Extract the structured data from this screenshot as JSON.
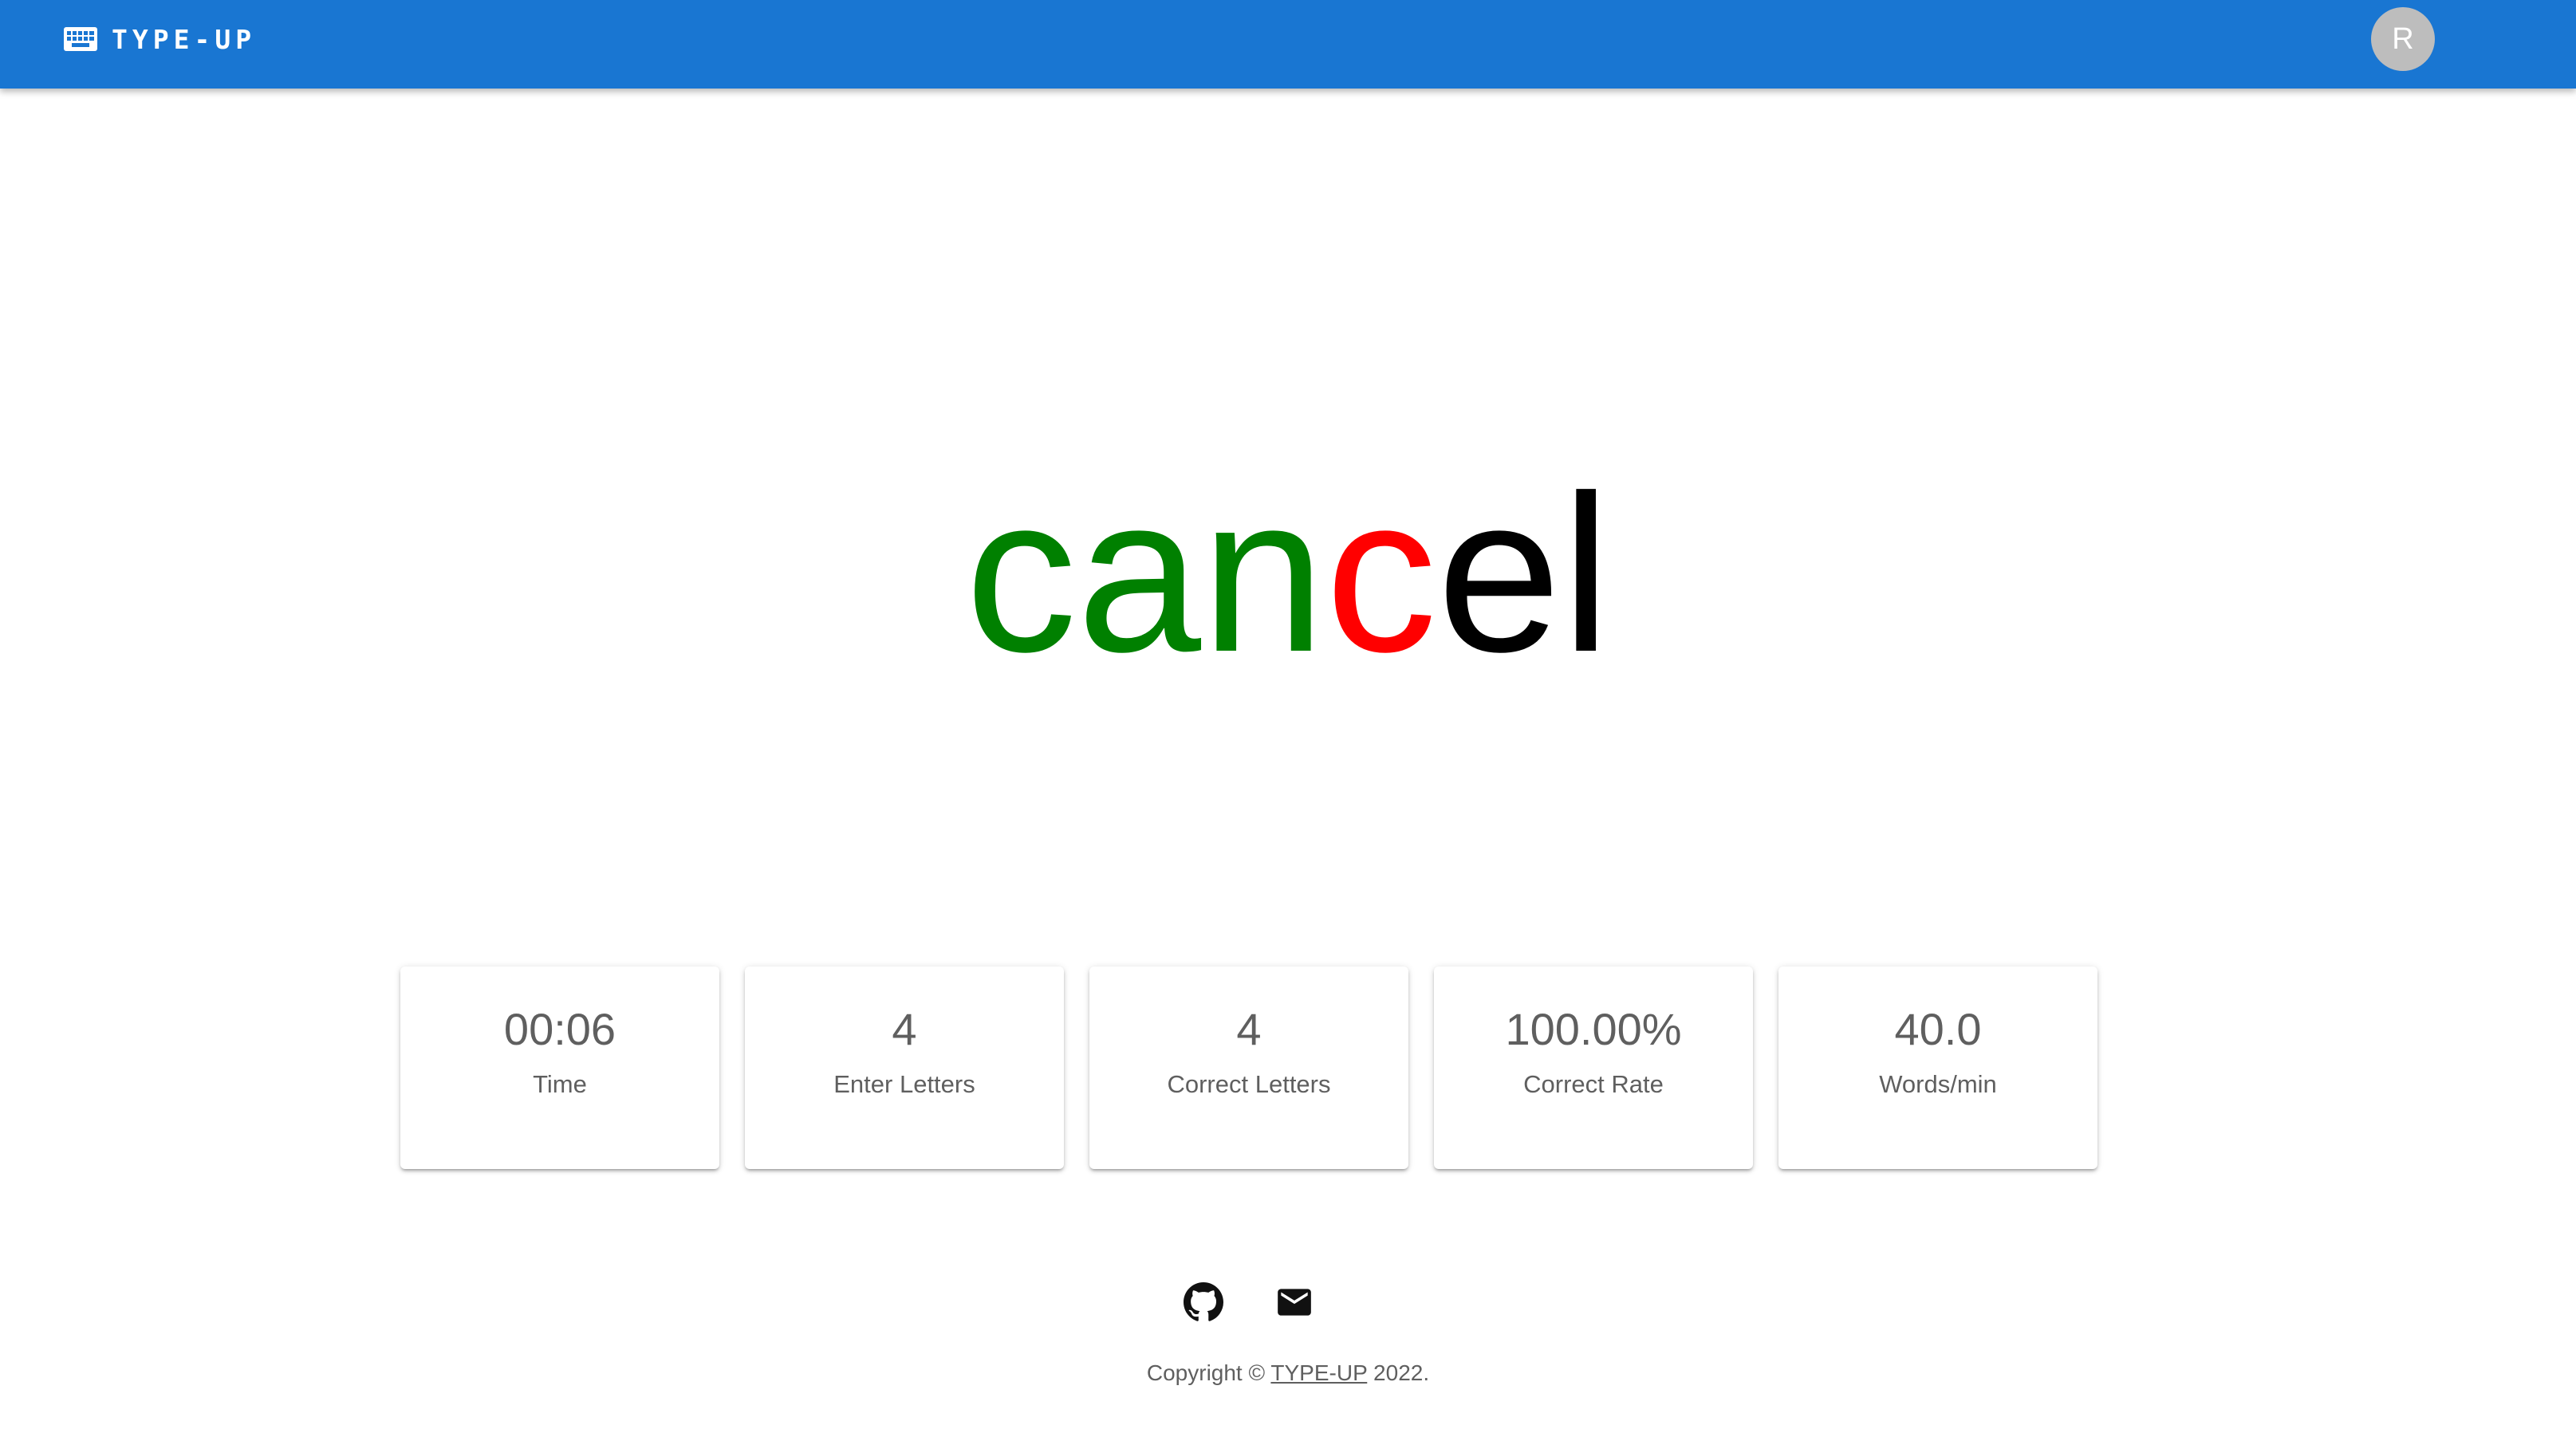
{
  "header": {
    "brand_name": "TYPE-UP",
    "brand_icon": "keyboard-icon",
    "avatar_initial": "R",
    "background_color": "#1976d2"
  },
  "practice": {
    "word": "cancel",
    "letters": [
      {
        "char": "c",
        "state": "correct"
      },
      {
        "char": "a",
        "state": "correct"
      },
      {
        "char": "n",
        "state": "correct"
      },
      {
        "char": "c",
        "state": "incorrect"
      },
      {
        "char": "e",
        "state": "pending"
      },
      {
        "char": "l",
        "state": "pending"
      }
    ],
    "colors": {
      "correct": "#008000",
      "incorrect": "#ff0000",
      "pending": "#000000"
    }
  },
  "stats": [
    {
      "value": "00:06",
      "label": "Time"
    },
    {
      "value": "4",
      "label": "Enter Letters"
    },
    {
      "value": "4",
      "label": "Correct Letters"
    },
    {
      "value": "100.00%",
      "label": "Correct Rate"
    },
    {
      "value": "40.0",
      "label": "Words/min"
    }
  ],
  "footer": {
    "icons": [
      "github-icon",
      "mail-icon"
    ],
    "copyright_prefix": "Copyright © ",
    "copyright_link": "TYPE-UP",
    "copyright_suffix": " 2022."
  }
}
